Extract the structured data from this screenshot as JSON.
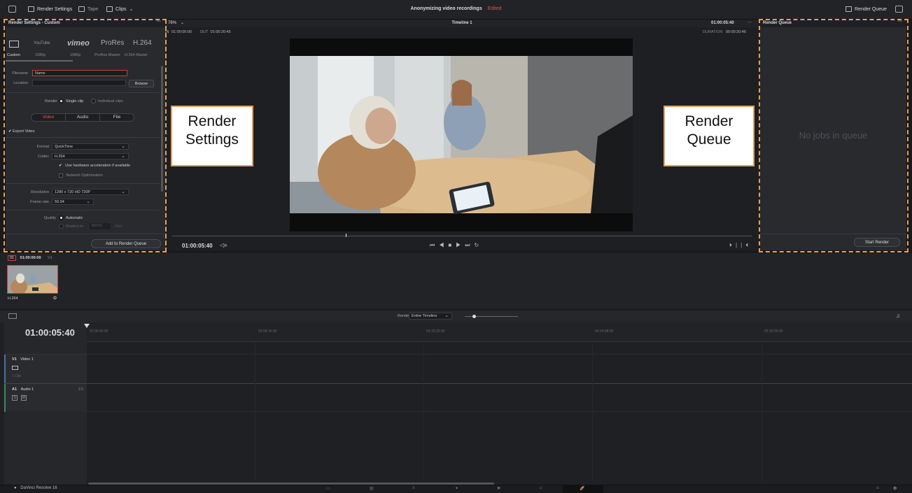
{
  "topbar": {
    "render_settings": "Render Settings",
    "tape": "Tape",
    "clips": "Clips",
    "project_title": "Anonymizing video recordings",
    "edited": "Edited",
    "render_queue": "Render Queue"
  },
  "render_settings": {
    "header": "Render Settings - Custom",
    "presets": [
      {
        "brand": "",
        "label": "Custom"
      },
      {
        "brand": "YouTube",
        "label": "1080p"
      },
      {
        "brand": "vimeo",
        "label": "1080p"
      },
      {
        "brand": "ProRes",
        "label": "ProRes Master"
      },
      {
        "brand": "H.264",
        "label": "H.264 Master"
      }
    ],
    "filename_label": "Filename",
    "filename_value": "Name",
    "location_label": "Location",
    "browse": "Browse",
    "render_label": "Render",
    "single_clip": "Single clip",
    "individual_clips": "Individual clips",
    "tabs": [
      "Video",
      "Audio",
      "File"
    ],
    "export_video": "Export Video",
    "format_label": "Format",
    "format_value": "QuickTime",
    "codec_label": "Codec",
    "codec_value": "H.264",
    "hw_accel": "Use hardware acceleration if available",
    "network_opt": "Network Optimization",
    "resolution_label": "Resolution",
    "resolution_value": "1280 x 720 HD 720P",
    "framerate_label": "Frame rate",
    "framerate_value": "59.94",
    "quality_label": "Quality",
    "quality_auto": "Automatic",
    "restrict_to": "Restrict to",
    "restrict_value": "80000",
    "restrict_unit": "Kb/s",
    "add_button": "Add to Render Queue"
  },
  "viewer": {
    "zoom": "76%",
    "timeline_name": "Timeline 1",
    "timecode_top": "01:00:05:40",
    "in_label": "IN",
    "in_tc": "01:00:00:00",
    "out_label": "OUT",
    "out_tc": "01:00:20:45",
    "duration_label": "DURATION",
    "duration_tc": "00:00:20:46",
    "current_tc": "01:00:05:40",
    "playhead_fraction": 0.3
  },
  "render_queue": {
    "header": "Render Queue",
    "empty": "No jobs in queue",
    "start": "Start Render"
  },
  "callouts": {
    "settings": "Render\nSettings",
    "queue": "Render\nQueue"
  },
  "clips": {
    "index": "01",
    "tc": "01:00:00:00",
    "track": "V1",
    "codec": "H.264"
  },
  "timeline": {
    "render_label": "Render",
    "render_value": "Entire Timeline",
    "current_tc": "01:00:05:40",
    "ruler": [
      "01:00:00:00",
      "02:08:16:00",
      "03:16:32:00",
      "04:24:48:00",
      "05:33:04:00"
    ],
    "v1_id": "V1",
    "v1_name": "Video 1",
    "v1_clips": "1 Clip",
    "a1_id": "A1",
    "a1_name": "Audio 1",
    "a1_ch": "2.0",
    "solo": "S",
    "mute": "M"
  },
  "footer": {
    "app": "DaVinci Resolve 16"
  },
  "colors": {
    "accent": "#e0a060",
    "edited": "#e0544f",
    "active_tab": "#e8534b"
  }
}
